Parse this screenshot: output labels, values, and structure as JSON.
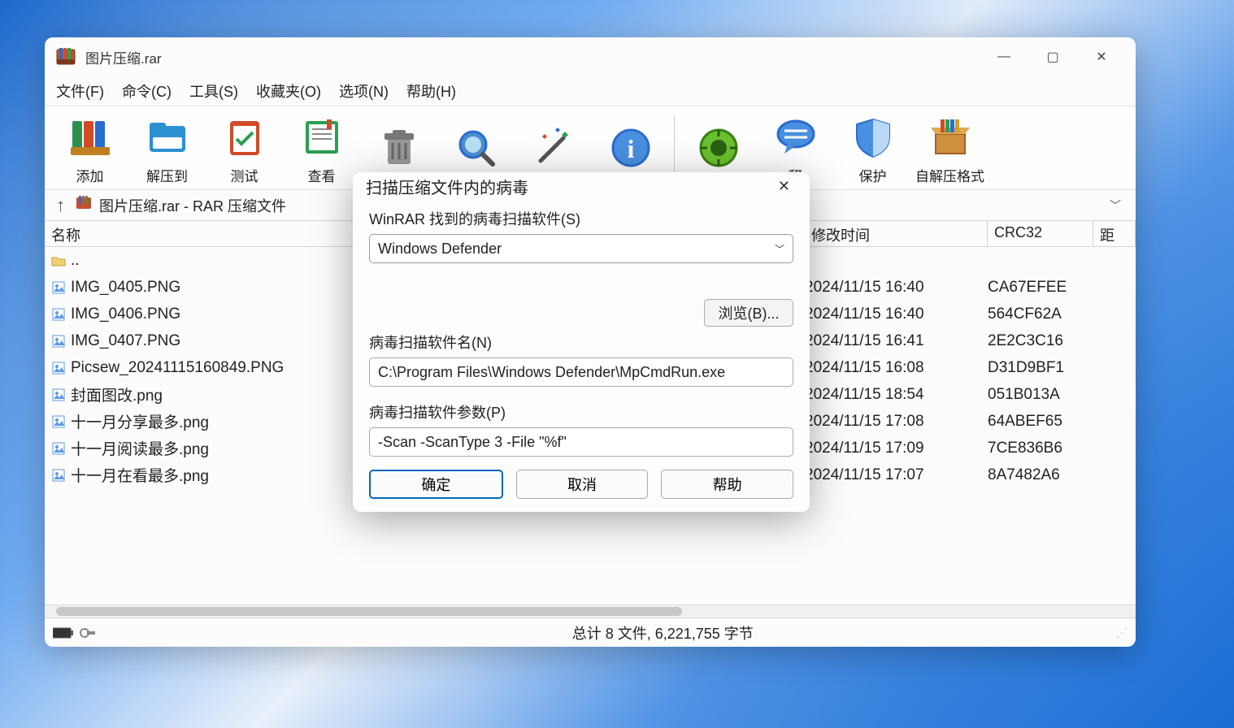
{
  "window": {
    "title": "图片压缩.rar",
    "controls": {
      "min": "—",
      "max": "▢",
      "close": "✕"
    }
  },
  "menu": {
    "file": "文件(F)",
    "command": "命令(C)",
    "tools": "工具(S)",
    "favorites": "收藏夹(O)",
    "options": "选项(N)",
    "help": "帮助(H)"
  },
  "toolbar": {
    "add": "添加",
    "extract_to": "解压到",
    "test": "测试",
    "view": "查看",
    "protect": "保护",
    "sfx": "自解压格式",
    "peek_right": "释"
  },
  "path": {
    "up": "↑",
    "text": "图片压缩.rar - RAR 压缩文件"
  },
  "columns": {
    "name": "名称",
    "date": "修改时间",
    "crc": "CRC32",
    "ext": "距"
  },
  "files": [
    {
      "name": "..",
      "date": "",
      "crc": "",
      "folder": true
    },
    {
      "name": "IMG_0405.PNG",
      "date": "2024/11/15 16:40",
      "crc": "CA67EFEE"
    },
    {
      "name": "IMG_0406.PNG",
      "date": "2024/11/15 16:40",
      "crc": "564CF62A"
    },
    {
      "name": "IMG_0407.PNG",
      "date": "2024/11/15 16:41",
      "crc": "2E2C3C16"
    },
    {
      "name": "Picsew_20241115160849.PNG",
      "date": "2024/11/15 16:08",
      "crc": "D31D9BF1"
    },
    {
      "name": "封面图改.png",
      "date": "2024/11/15 18:54",
      "crc": "051B013A"
    },
    {
      "name": "十一月分享最多.png",
      "date": "2024/11/15 17:08",
      "crc": "64ABEF65"
    },
    {
      "name": "十一月阅读最多.png",
      "date": "2024/11/15 17:09",
      "crc": "7CE836B6"
    },
    {
      "name": "十一月在看最多.png",
      "date": "2024/11/15 17:07",
      "crc": "8A7482A6"
    }
  ],
  "status": {
    "summary": "总计 8 文件, 6,221,755 字节"
  },
  "dialog": {
    "title": "扫描压缩文件内的病毒",
    "scanner_label": "WinRAR 找到的病毒扫描软件(S)",
    "scanner_value": "Windows Defender",
    "browse": "浏览(B)...",
    "name_label": "病毒扫描软件名(N)",
    "name_value": "C:\\Program Files\\Windows Defender\\MpCmdRun.exe",
    "param_label": "病毒扫描软件参数(P)",
    "param_value": "-Scan -ScanType 3 -File \"%f\"",
    "ok": "确定",
    "cancel": "取消",
    "help": "帮助"
  }
}
